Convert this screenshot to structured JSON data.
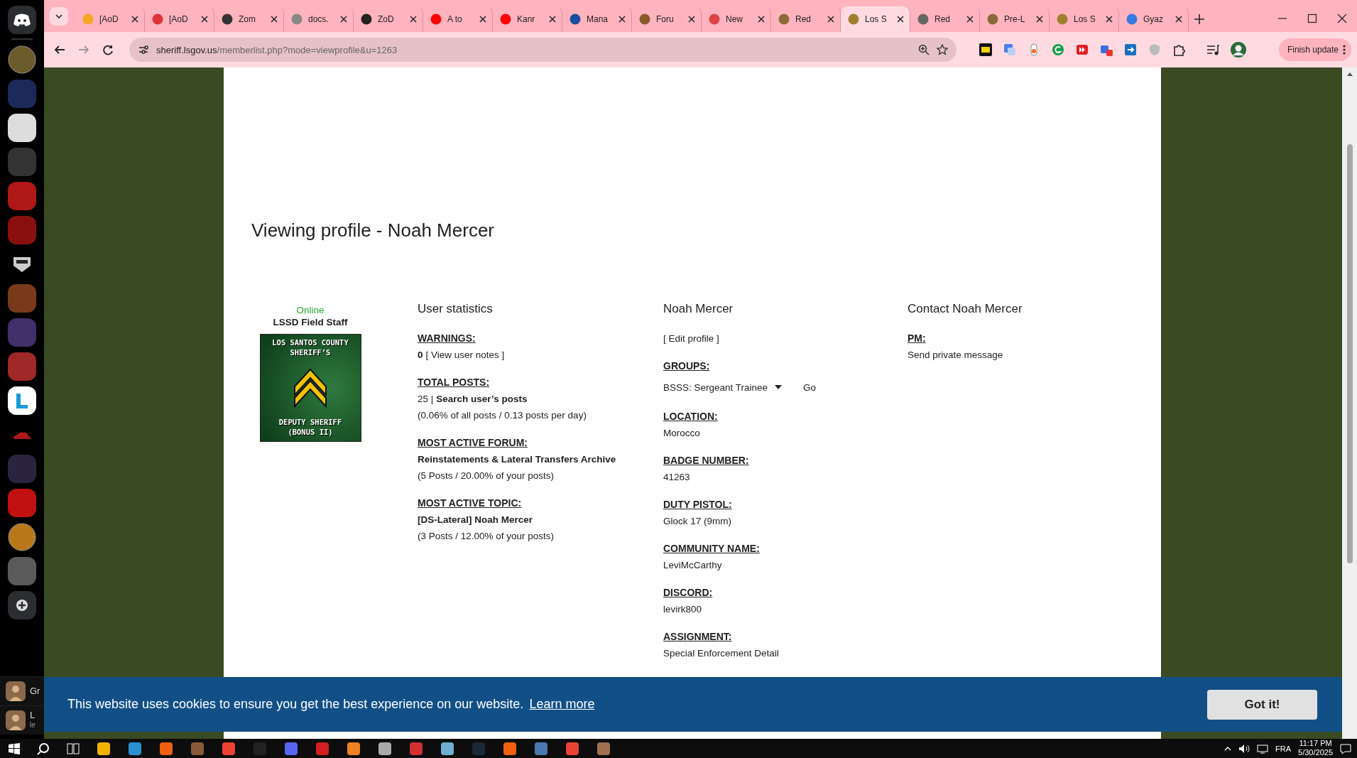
{
  "discord": {
    "panels": [
      {
        "name": "Gr"
      },
      {
        "name": "L",
        "sub": "le"
      }
    ]
  },
  "browser": {
    "tabs": [
      {
        "label": "[AoD",
        "selected": false
      },
      {
        "label": "[AoD",
        "selected": false
      },
      {
        "label": "Zom",
        "selected": false
      },
      {
        "label": "docs.",
        "selected": false
      },
      {
        "label": "ZoD",
        "selected": false
      },
      {
        "label": "A to",
        "selected": false
      },
      {
        "label": "Kanr",
        "selected": false
      },
      {
        "label": "Mana",
        "selected": false
      },
      {
        "label": "Foru",
        "selected": false
      },
      {
        "label": "New",
        "selected": false
      },
      {
        "label": "Red",
        "selected": false
      },
      {
        "label": "Los S",
        "selected": true
      },
      {
        "label": "Red",
        "selected": false
      },
      {
        "label": "Pre-L",
        "selected": false
      },
      {
        "label": "Los S",
        "selected": false
      },
      {
        "label": "Gyaz",
        "selected": false
      }
    ],
    "url_host": "sheriff.lsgov.us",
    "url_path": "/memberlist.php?mode=viewprofile&u=1263",
    "update_button": "Finish update"
  },
  "profile": {
    "title": "Viewing profile - Noah Mercer",
    "status": "Online",
    "rank": "LSSD Field Staff",
    "rank_badge": {
      "top": "LOS SANTOS COUNTY SHERIFF’S",
      "bottom": "DEPUTY SHERIFF (BONUS II)"
    },
    "statistics": {
      "heading": "User statistics",
      "blocks": [
        {
          "label": "WARNINGS:",
          "lines": [
            [
              {
                "kind": "bold",
                "text": "0"
              },
              {
                "kind": "link",
                "text": "[ View user notes ]"
              }
            ]
          ]
        },
        {
          "label": "TOTAL POSTS:",
          "lines": [
            [
              {
                "kind": "plain",
                "text": "25 |"
              },
              {
                "kind": "boldlink",
                "text": "Search user’s posts"
              }
            ],
            [
              {
                "kind": "plain",
                "text": "(0.06% of all posts / 0.13 posts per day)"
              }
            ]
          ]
        },
        {
          "label": "MOST ACTIVE FORUM:",
          "lines": [
            [
              {
                "kind": "boldlink",
                "text": "Reinstatements & Lateral Transfers Archive"
              }
            ],
            [
              {
                "kind": "plain",
                "text": "(5 Posts / 20.00% of your posts)"
              }
            ]
          ]
        },
        {
          "label": "MOST ACTIVE TOPIC:",
          "lines": [
            [
              {
                "kind": "boldlink",
                "text": "[DS-Lateral] Noah Mercer"
              }
            ],
            [
              {
                "kind": "plain",
                "text": "(3 Posts / 12.00% of your posts)"
              }
            ]
          ]
        }
      ]
    },
    "details": {
      "heading": "Noah Mercer",
      "edit_link": "[ Edit profile ]",
      "fields": [
        {
          "kind": "select",
          "label": "GROUPS:",
          "value": "BSSS: Sergeant Trainee",
          "button": "Go"
        },
        {
          "kind": "text",
          "label": "LOCATION:",
          "value": "Morocco"
        },
        {
          "kind": "text",
          "label": "BADGE NUMBER:",
          "value": "41263"
        },
        {
          "kind": "text",
          "label": "DUTY PISTOL:",
          "value": "Glock 17 (9mm)"
        },
        {
          "kind": "text",
          "label": "COMMUNITY NAME:",
          "value": "LeviMcCarthy"
        },
        {
          "kind": "text",
          "label": "DISCORD:",
          "value": "levirk800"
        },
        {
          "kind": "text",
          "label": "ASSIGNMENT:",
          "value": "Special Enforcement Detail"
        }
      ]
    },
    "contact": {
      "heading": "Contact Noah Mercer",
      "fields": [
        {
          "kind": "link",
          "label": "PM:",
          "value": "Send private message"
        }
      ]
    }
  },
  "cookie_bar": {
    "message": "This website uses cookies to ensure you get the best experience on our website.",
    "link": "Learn more",
    "button": "Got it!"
  },
  "taskbar": {
    "language": "FRA",
    "time": "11:17 PM",
    "date": "5/30/2025"
  }
}
